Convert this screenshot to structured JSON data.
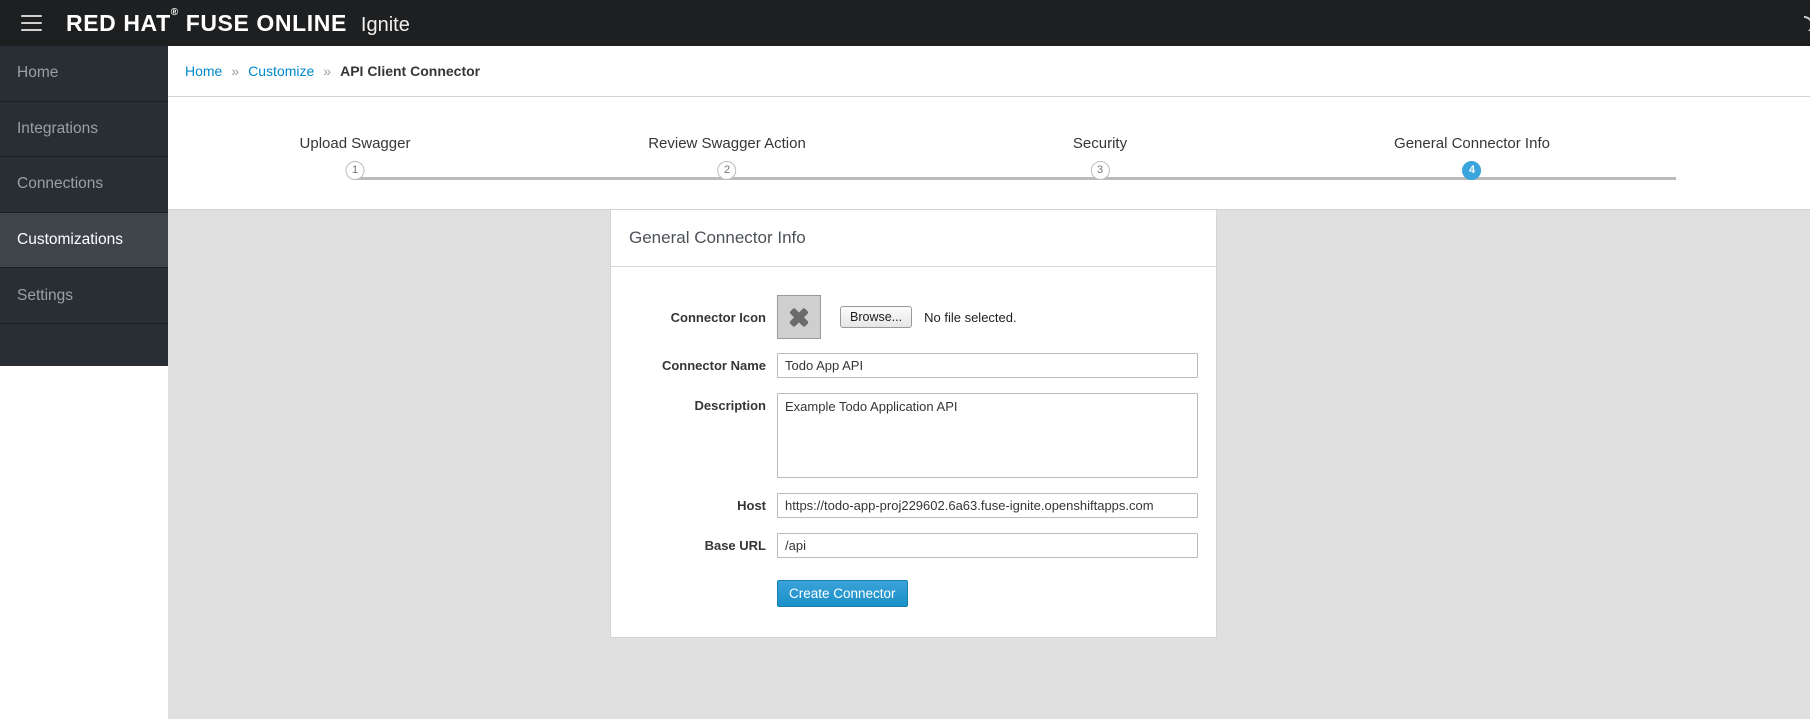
{
  "navbar": {
    "menu_icon": "hamburger-icon",
    "brand_primary": "RED HAT",
    "brand_registered": "®",
    "brand_secondary": "FUSE ONLINE",
    "brand_subtitle": "Ignite",
    "right_icon": "help-circle-icon"
  },
  "sidebar": {
    "items": [
      {
        "label": "Home",
        "active": false
      },
      {
        "label": "Integrations",
        "active": false
      },
      {
        "label": "Connections",
        "active": false
      },
      {
        "label": "Customizations",
        "active": true
      },
      {
        "label": "Settings",
        "active": false
      }
    ]
  },
  "breadcrumb": {
    "separator": "»",
    "items": [
      {
        "label": "Home",
        "link": true
      },
      {
        "label": "Customize",
        "link": true
      },
      {
        "label": "API Client Connector",
        "link": false
      }
    ]
  },
  "wizard": {
    "steps": [
      {
        "number": "1",
        "label": "Upload Swagger",
        "active": false
      },
      {
        "number": "2",
        "label": "Review Swagger Action",
        "active": false
      },
      {
        "number": "3",
        "label": "Security",
        "active": false
      },
      {
        "number": "4",
        "label": "General Connector Info",
        "active": true
      }
    ]
  },
  "form": {
    "card_title": "General Connector Info",
    "icon_field": {
      "label": "Connector Icon",
      "preview_icon": "broken-image-icon",
      "browse_label": "Browse...",
      "file_status": "No file selected."
    },
    "fields": [
      {
        "label": "Connector Name",
        "value": "Todo App API",
        "placeholder": "",
        "type": "text"
      },
      {
        "label": "Description",
        "value": "Example Todo Application API",
        "placeholder": "",
        "type": "textarea"
      },
      {
        "label": "Host",
        "value": "https://todo-app-proj229602.6a63.fuse-ignite.openshiftapps.com",
        "placeholder": "",
        "type": "text"
      },
      {
        "label": "Base URL",
        "value": "/api",
        "placeholder": "",
        "type": "text"
      }
    ],
    "submit_label": "Create Connector"
  },
  "colors": {
    "navbar_bg": "#1d1f21",
    "sidebar_bg": "#292e34",
    "sidebar_active_bg": "#3f454b",
    "link_blue": "#0088ce",
    "accent_blue": "#39a5dc",
    "content_bg": "#e0e0e0"
  }
}
